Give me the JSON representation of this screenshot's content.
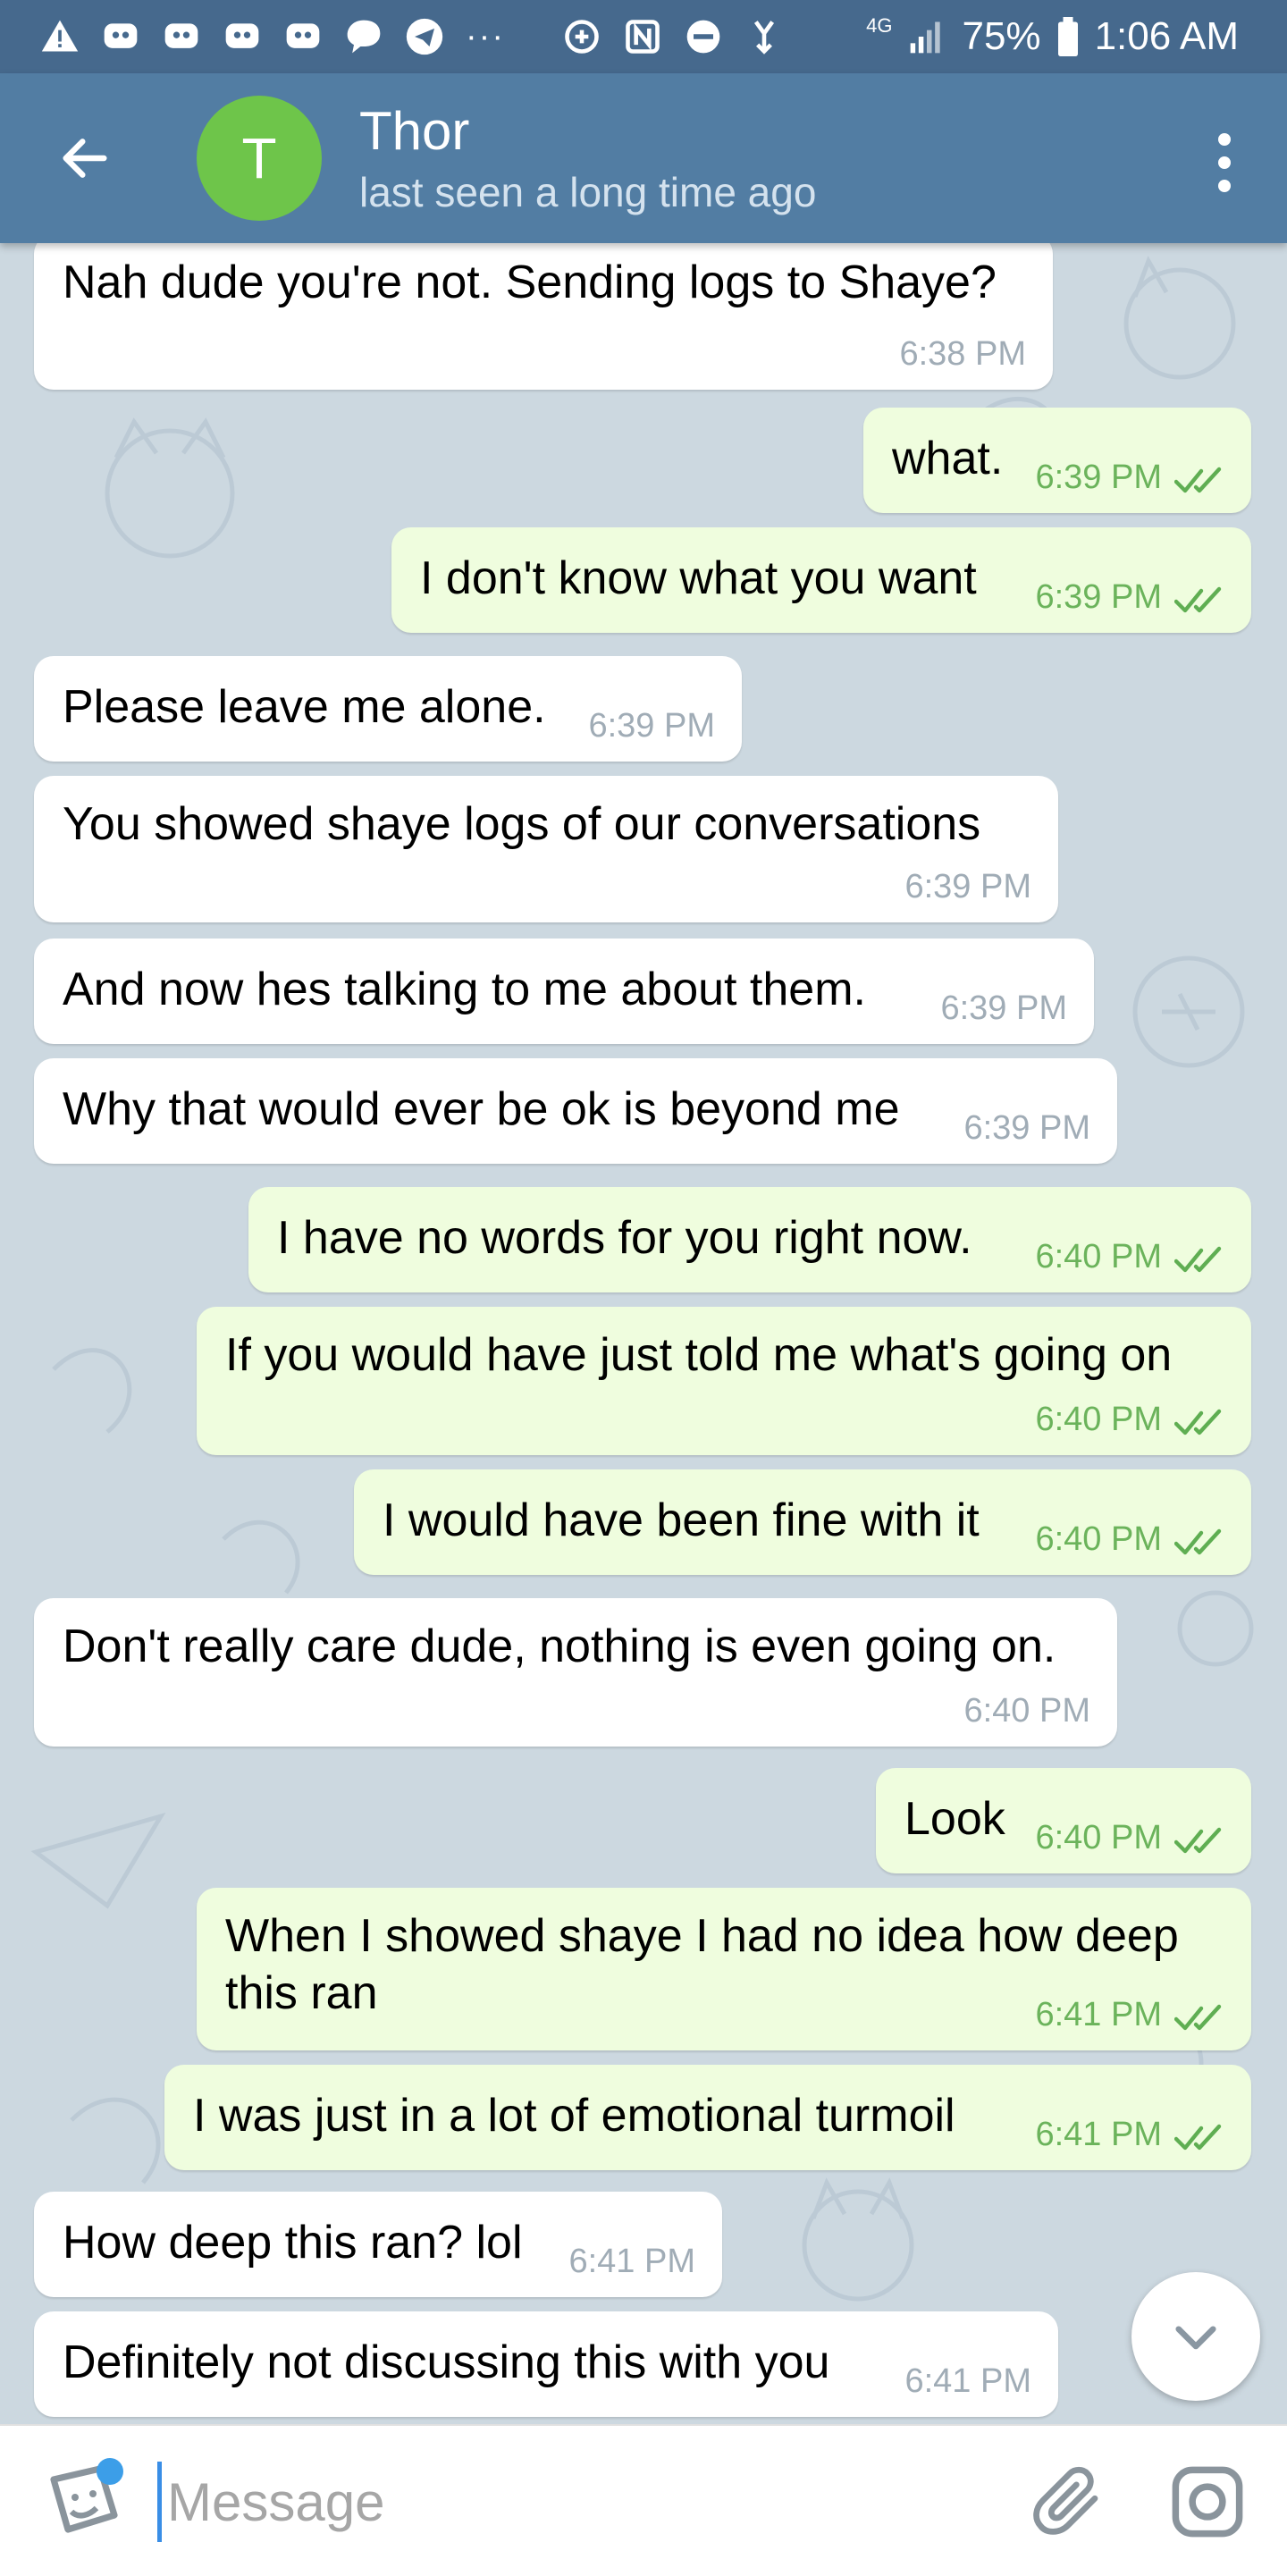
{
  "status_bar": {
    "battery": "75%",
    "time": "1:06 AM",
    "network": "4G",
    "icons": [
      "warning-icon",
      "discord-icon",
      "discord-icon",
      "discord-icon",
      "discord-icon",
      "chat-bubble-icon",
      "telegram-icon",
      "more-dots-icon",
      "data-saver-icon",
      "nfc-icon",
      "do-not-disturb-icon",
      "network-data-icon",
      "signal-icon",
      "battery-icon"
    ]
  },
  "header": {
    "avatar_initial": "T",
    "avatar_color": "#6ec54a",
    "name": "Thor",
    "status": "last seen a long time ago"
  },
  "messages": [
    {
      "dir": "in",
      "text": "Nah dude you're not. Sending logs to Shaye?",
      "time": "6:38 PM"
    },
    {
      "dir": "out",
      "text": "what.",
      "time": "6:39 PM",
      "read": true
    },
    {
      "dir": "out",
      "text": "I don't know what you want",
      "time": "6:39 PM",
      "read": true
    },
    {
      "dir": "in",
      "text": "Please leave me alone.",
      "time": "6:39 PM"
    },
    {
      "dir": "in",
      "text": "You showed shaye logs of our conversations",
      "time": "6:39 PM"
    },
    {
      "dir": "in",
      "text": "And now hes talking to me about them.",
      "time": "6:39 PM"
    },
    {
      "dir": "in",
      "text": "Why that would ever be ok is beyond me",
      "time": "6:39 PM"
    },
    {
      "dir": "out",
      "text": "I have no words for you right now.",
      "time": "6:40 PM",
      "read": true
    },
    {
      "dir": "out",
      "text": "If you would have just told me what's going on",
      "time": "6:40 PM",
      "read": true
    },
    {
      "dir": "out",
      "text": "I would have been fine with it",
      "time": "6:40 PM",
      "read": true
    },
    {
      "dir": "in",
      "text": "Don't really care dude, nothing is even going on.",
      "time": "6:40 PM"
    },
    {
      "dir": "out",
      "text": "Look",
      "time": "6:40 PM",
      "read": true
    },
    {
      "dir": "out",
      "text": "When I showed shaye I had no idea how deep\nthis ran",
      "time": "6:41 PM",
      "read": true
    },
    {
      "dir": "out",
      "text": "I was just in a lot of emotional turmoil",
      "time": "6:41 PM",
      "read": true
    },
    {
      "dir": "in",
      "text": "How deep this ran? lol",
      "time": "6:41 PM"
    },
    {
      "dir": "in",
      "text": "Definitely not discussing this with you",
      "time": "6:41 PM"
    }
  ],
  "composer": {
    "placeholder": "Message"
  },
  "colors": {
    "header": "#527da3",
    "status_bar": "#46698d",
    "incoming_bubble": "#ffffff",
    "outgoing_bubble": "#effdde",
    "outgoing_time": "#6bb35b",
    "incoming_time": "#a0acb6"
  }
}
